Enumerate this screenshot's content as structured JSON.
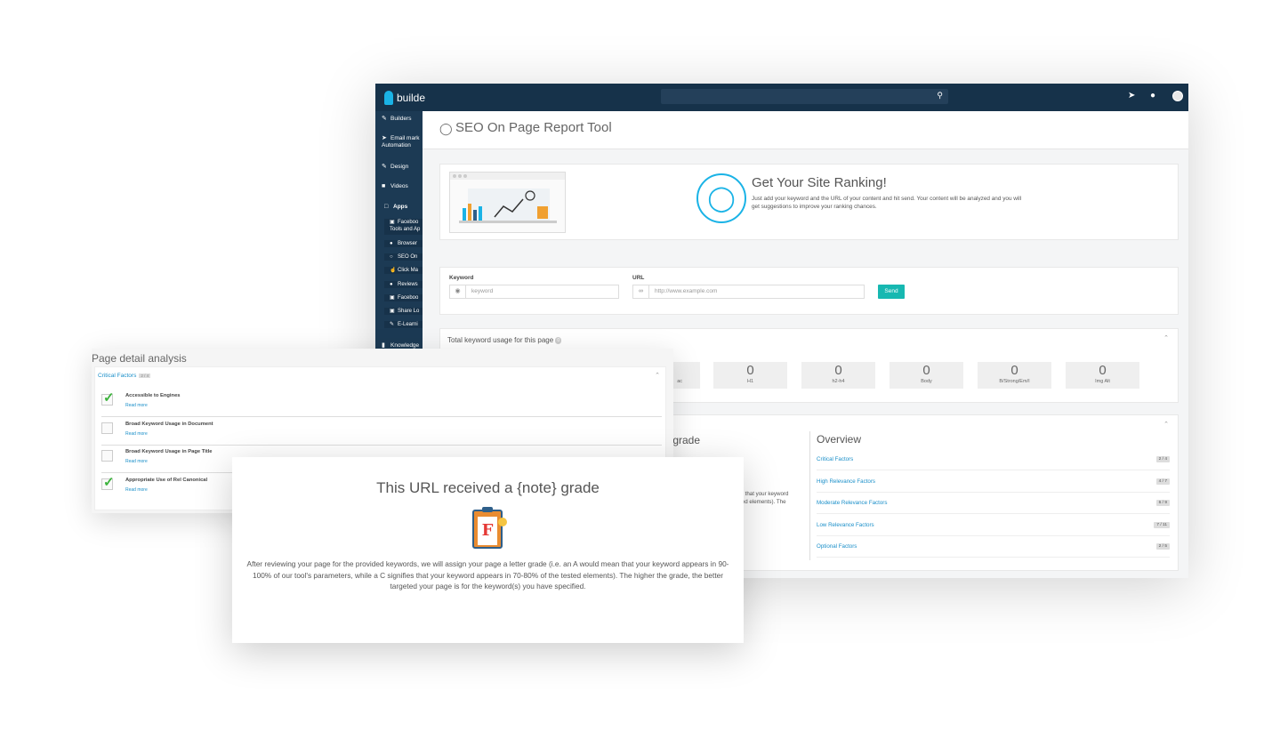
{
  "app": {
    "brand": "builde"
  },
  "topbar": {
    "icons": [
      "search-icon",
      "rocket-icon",
      "bell-icon",
      "avatar"
    ]
  },
  "sidebar": {
    "items": [
      {
        "label": "Builders",
        "icon": "pencil-icon"
      },
      {
        "label": "Email mark",
        "label2": "Automation",
        "icon": "send-icon"
      },
      {
        "label": "Design",
        "icon": "pencil-icon"
      },
      {
        "label": "Videos",
        "icon": "video-icon"
      },
      {
        "label": "Apps",
        "icon": "square-icon"
      },
      {
        "label": "Knowledge",
        "icon": "book-icon"
      }
    ],
    "subitems": [
      {
        "label": "Faceboo",
        "label2": "Tools and Ap",
        "icon": "facebook-icon"
      },
      {
        "label": "Browser",
        "icon": "bell-icon"
      },
      {
        "label": "SEO On",
        "icon": "bulb-icon"
      },
      {
        "label": "Click Ma",
        "icon": "pointer-icon"
      },
      {
        "label": "Reviews",
        "icon": "chat-icon"
      },
      {
        "label": "Faceboo",
        "icon": "facebook-icon"
      },
      {
        "label": "Share Lo",
        "icon": "facebook-icon"
      },
      {
        "label": "E-Learni",
        "icon": "pencil-icon"
      }
    ]
  },
  "page": {
    "title": "SEO On Page Report Tool"
  },
  "hero": {
    "title": "Get Your Site Ranking!",
    "text": "Just add your keyword and the URL of your content and hit send. Your content will be analyzed and you will get suggestions to improve your ranking chances."
  },
  "form": {
    "keyword_label": "Keyword",
    "keyword_placeholder": "keyword",
    "url_label": "URL",
    "url_placeholder": "http://www.example.com",
    "send_label": "Send"
  },
  "usage": {
    "title": "Total keyword usage for this page",
    "badge": "0",
    "partial_label": "ac",
    "metrics": [
      {
        "value": "0",
        "label": "H1"
      },
      {
        "value": "0",
        "label": "h2-h4"
      },
      {
        "value": "0",
        "label": "Body"
      },
      {
        "value": "0",
        "label": "B/Strong/Em/I"
      },
      {
        "value": "0",
        "label": "Img Alt"
      }
    ]
  },
  "grade_section": {
    "partial_title": "} grade",
    "partial_text1": "an that your keyword",
    "partial_text2": "sted elements). The"
  },
  "overview": {
    "title": "Overview",
    "rows": [
      {
        "label": "Critical Factors",
        "count": "2 / 4"
      },
      {
        "label": "High Relevance Factors",
        "count": "4 / 7"
      },
      {
        "label": "Moderate Relevance Factors",
        "count": "6 / 9"
      },
      {
        "label": "Low Relevance Factors",
        "count": "7 / 11"
      },
      {
        "label": "Optional Factors",
        "count": "2 / 5"
      }
    ]
  },
  "detail": {
    "title": "Page detail analysis",
    "critical_label": "Critical Factors",
    "critical_badge": "2 / 4",
    "factors": [
      {
        "label": "Accessible to Engines",
        "read_more": "Read more",
        "checked": true
      },
      {
        "label": "Broad Keyword Usage in Document",
        "read_more": "Read more",
        "checked": false
      },
      {
        "label": "Broad Keyword Usage in Page Title",
        "read_more": "Read more",
        "checked": false
      },
      {
        "label": "Appropriate Use of Rel Canonical",
        "read_more": "Read more",
        "checked": true
      }
    ]
  },
  "grade_popup": {
    "title": "This URL received a {note} grade",
    "letter": "F",
    "text": "After reviewing your page for the provided keywords, we will assign your page a letter grade (i.e. an A would mean that your keyword appears in 90-100% of our tool's parameters, while a C signifies that your keyword appears in 70-80% of the tested elements). The higher the grade, the better targeted your page is for the keyword(s) you have specified."
  },
  "colors": {
    "topbar": "#16324a",
    "sidebar": "#1c3a54",
    "accent": "#1ab3e6",
    "send": "#17b8b1",
    "link": "#1a8fc9",
    "check": "#3db33d"
  }
}
